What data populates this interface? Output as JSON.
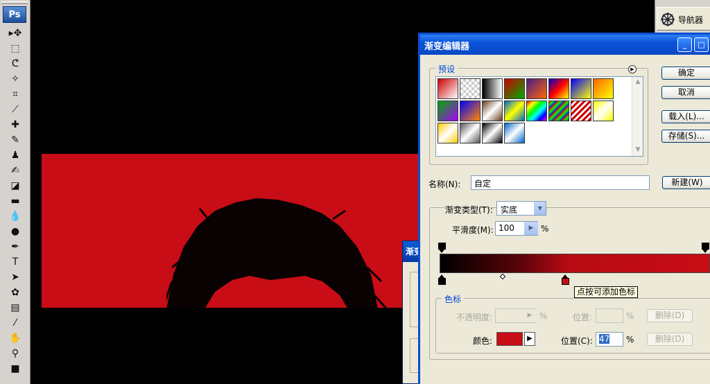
{
  "toolbox": {
    "logo": "Ps",
    "tools": [
      {
        "name": "move-tool",
        "glyph": "▸✥"
      },
      {
        "name": "marquee-tool",
        "glyph": "⬚"
      },
      {
        "name": "lasso-tool",
        "glyph": "ᕦ"
      },
      {
        "name": "magic-wand-tool",
        "glyph": "✧"
      },
      {
        "name": "crop-tool",
        "glyph": "⌗"
      },
      {
        "name": "slice-tool",
        "glyph": "⟋"
      },
      {
        "name": "healing-brush-tool",
        "glyph": "✚"
      },
      {
        "name": "brush-tool",
        "glyph": "✎"
      },
      {
        "name": "clone-stamp-tool",
        "glyph": "♟"
      },
      {
        "name": "history-brush-tool",
        "glyph": "✍"
      },
      {
        "name": "eraser-tool",
        "glyph": "◪"
      },
      {
        "name": "gradient-tool",
        "glyph": "▬"
      },
      {
        "name": "blur-tool",
        "glyph": "💧"
      },
      {
        "name": "dodge-tool",
        "glyph": "●"
      },
      {
        "name": "pen-tool",
        "glyph": "✒"
      },
      {
        "name": "type-tool",
        "glyph": "T"
      },
      {
        "name": "path-selection-tool",
        "glyph": "➤"
      },
      {
        "name": "custom-shape-tool",
        "glyph": "✿"
      },
      {
        "name": "notes-tool",
        "glyph": "▤"
      },
      {
        "name": "eyedropper-tool",
        "glyph": "⁄"
      },
      {
        "name": "hand-tool",
        "glyph": "✋"
      },
      {
        "name": "zoom-tool",
        "glyph": "⚲"
      },
      {
        "name": "color-swatches",
        "glyph": "■"
      }
    ]
  },
  "navigator": {
    "label": "导航器"
  },
  "back_dialog": {
    "title": "渐变"
  },
  "dialog": {
    "title": "渐变编辑器",
    "presets_label": "预设",
    "buttons": {
      "ok": "确定",
      "cancel": "取消",
      "load": "载入(L)...",
      "save": "存储(S)...",
      "new": "新建(W)"
    },
    "name_label": "名称(N):",
    "name_value": "自定",
    "type_label": "渐变类型(T):",
    "type_value": "实底",
    "smooth_label": "平滑度(M):",
    "smooth_value": "100",
    "smooth_unit": "%",
    "tooltip": "点按可添加色标",
    "stops_group": "色标",
    "opacity_label": "不透明度:",
    "opacity_unit": "%",
    "opacity_location_label": "位置:",
    "opacity_location_unit": "%",
    "delete_label": "删除(D)",
    "color_label": "颜色:",
    "color_location_label": "位置(C):",
    "color_location_value": "47",
    "color_location_unit": "%",
    "delete_label_2": "删除(D)",
    "accent_color": "#c80d16"
  }
}
